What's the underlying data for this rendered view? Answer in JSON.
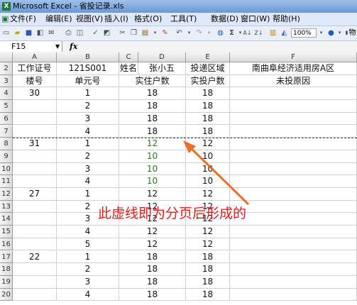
{
  "window": {
    "title": "Microsoft Excel - 省投记录.xls"
  },
  "menu": [
    "文件(F)",
    "编辑(E)",
    "视图(V)",
    "插入(I)",
    "格式(O)",
    "工具(T)",
    "数据(D)",
    "窗口(W)",
    "帮助(H)"
  ],
  "toolbar": {
    "zoom": "100%",
    "right_label": "物"
  },
  "formula_bar": {
    "name_box": "F15",
    "fx": "fx",
    "value": ""
  },
  "columns": [
    "A",
    "B",
    "C",
    "D",
    "E",
    "F"
  ],
  "rows": [
    {
      "n": "2",
      "cells": [
        "工作证号",
        "121S001",
        "姓名",
        "张小五",
        "投递区域",
        "南曲阜经济适用房A区"
      ]
    },
    {
      "n": "3",
      "cells": [
        "楼号",
        "单元号",
        "实住户数",
        "",
        "实投户数",
        "未投原因"
      ]
    },
    {
      "n": "4",
      "cells": [
        "30",
        "1",
        "18",
        "",
        "18",
        ""
      ]
    },
    {
      "n": "5",
      "cells": [
        "",
        "2",
        "18",
        "",
        "18",
        ""
      ]
    },
    {
      "n": "6",
      "cells": [
        "",
        "3",
        "18",
        "",
        "18",
        ""
      ]
    },
    {
      "n": "7",
      "cells": [
        "",
        "4",
        "18",
        "",
        "18",
        ""
      ]
    },
    {
      "n": "8",
      "cells": [
        "31",
        "1",
        "12",
        "",
        "12",
        ""
      ]
    },
    {
      "n": "9",
      "cells": [
        "",
        "2",
        "10",
        "",
        "10",
        ""
      ]
    },
    {
      "n": "10",
      "cells": [
        "",
        "3",
        "10",
        "",
        "10",
        ""
      ]
    },
    {
      "n": "11",
      "cells": [
        "",
        "4",
        "10",
        "",
        "10",
        ""
      ]
    },
    {
      "n": "12",
      "cells": [
        "27",
        "1",
        "12",
        "",
        "12",
        ""
      ]
    },
    {
      "n": "13",
      "cells": [
        "",
        "2",
        "12",
        "",
        "12",
        ""
      ]
    },
    {
      "n": "14",
      "cells": [
        "",
        "3",
        "12",
        "",
        "12",
        ""
      ]
    },
    {
      "n": "15",
      "cells": [
        "",
        "4",
        "12",
        "",
        "12",
        ""
      ]
    },
    {
      "n": "16",
      "cells": [
        "",
        "5",
        "12",
        "",
        "12",
        ""
      ]
    },
    {
      "n": "17",
      "cells": [
        "22",
        "1",
        "18",
        "",
        "18",
        ""
      ]
    },
    {
      "n": "18",
      "cells": [
        "",
        "2",
        "18",
        "",
        "18",
        ""
      ]
    },
    {
      "n": "19",
      "cells": [
        "",
        "3",
        "18",
        "",
        "18",
        ""
      ]
    },
    {
      "n": "20",
      "cells": [
        "",
        "4",
        "18",
        "",
        "18",
        ""
      ]
    }
  ],
  "annotation": "此虚线即为分页后形成的",
  "colors": {
    "annotation": "#e02020",
    "green_values": "#2a7a1a"
  }
}
